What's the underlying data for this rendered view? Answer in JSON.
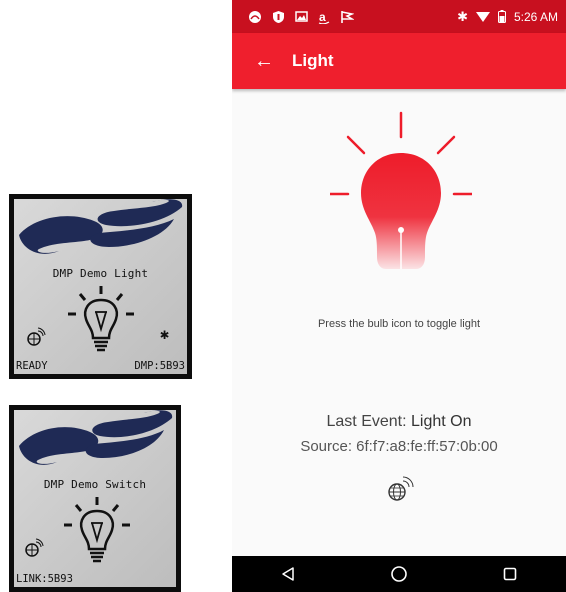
{
  "lcd_light": {
    "title": "DMP Demo Light",
    "status_left": "READY",
    "status_right": "DMP:5B93"
  },
  "lcd_switch": {
    "title": "DMP Demo Switch",
    "status_left": "LINK:5B93"
  },
  "status_bar": {
    "time": "5:26 AM",
    "icons": [
      "app-icon",
      "shield-icon",
      "photo-icon",
      "amazon-icon",
      "flag-icon",
      "bluetooth-icon",
      "wifi-icon",
      "battery-icon"
    ]
  },
  "app_bar": {
    "title": "Light",
    "color": "#ef1f2d"
  },
  "main": {
    "bulb_state": "on",
    "bulb_color": "#ee1c2a",
    "hint": "Press the bulb icon to toggle light",
    "last_event_label": "Last Event:",
    "last_event_value": "Light On",
    "source": "Source: 6f:f7:a8:fe:ff:57:0b:00"
  },
  "nav_bar": {
    "buttons": [
      "back-triangle-icon",
      "home-circle-icon",
      "recents-square-icon"
    ]
  }
}
